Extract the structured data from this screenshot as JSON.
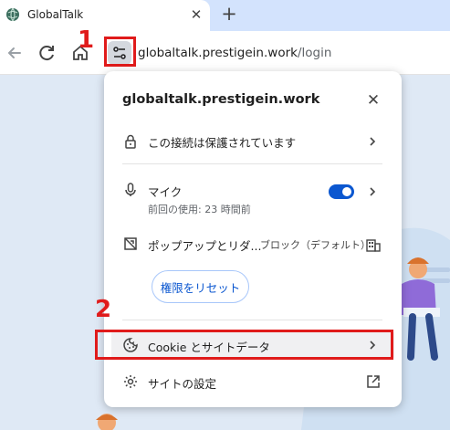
{
  "tab": {
    "title": "GlobalTalk",
    "close_icon": "close-icon"
  },
  "toolbar": {
    "url_domain": "globaltalk.prestigein.work",
    "url_path": "/login"
  },
  "popup": {
    "domain": "globaltalk.prestigein.work",
    "connection_label": "この接続は保護されています",
    "mic_label": "マイク",
    "mic_sub": "前回の使用: 23 時間前",
    "mic_enabled": true,
    "popup_label": "ポップアップとリダ...",
    "popup_value": "ブロック（デフォルト）",
    "reset_label": "権限をリセット",
    "cookie_label": "Cookie とサイトデータ",
    "site_settings_label": "サイトの設定"
  },
  "annotations": {
    "step1": "1",
    "step2": "2",
    "color": "#e01b1b"
  },
  "colors": {
    "accent": "#0b57d0",
    "tabstrip": "#d3e3fd"
  }
}
